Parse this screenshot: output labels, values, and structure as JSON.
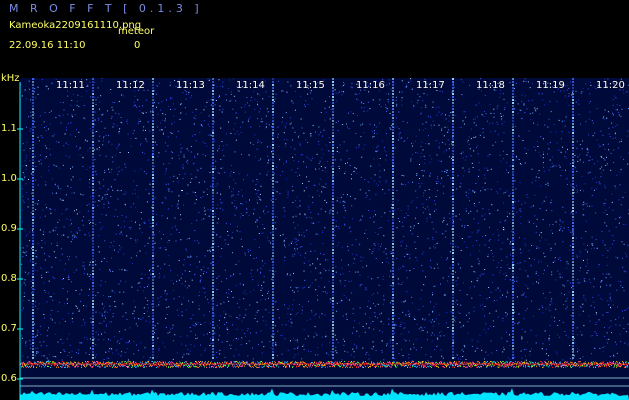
{
  "header": {
    "app_title": "M R O F F T  [ 0.1.3 ]",
    "file_name": "Kameoka2209161110.png",
    "tag_label": "meteor",
    "timestamp": "22.09.16  11:10",
    "count": "0"
  },
  "colors": {
    "background": "#000000",
    "title": "#7c8ce6",
    "label": "#ffff66",
    "axis": "#00ffff",
    "noise_floor": "#00e5ff",
    "spectrum_band": "#ff3030"
  },
  "chart_data": {
    "type": "heatmap",
    "ylabel": "kHz",
    "y_ticks": [
      "1.1",
      "1.0",
      "0.9",
      "0.8",
      "0.7",
      "0.6"
    ],
    "x_ticks": [
      "11:11",
      "11:12",
      "11:13",
      "11:14",
      "11:15",
      "11:16",
      "11:17",
      "11:18",
      "11:19",
      "11:20"
    ],
    "ylim": [
      0.58,
      1.18
    ],
    "carrier_khz": 0.63
  }
}
